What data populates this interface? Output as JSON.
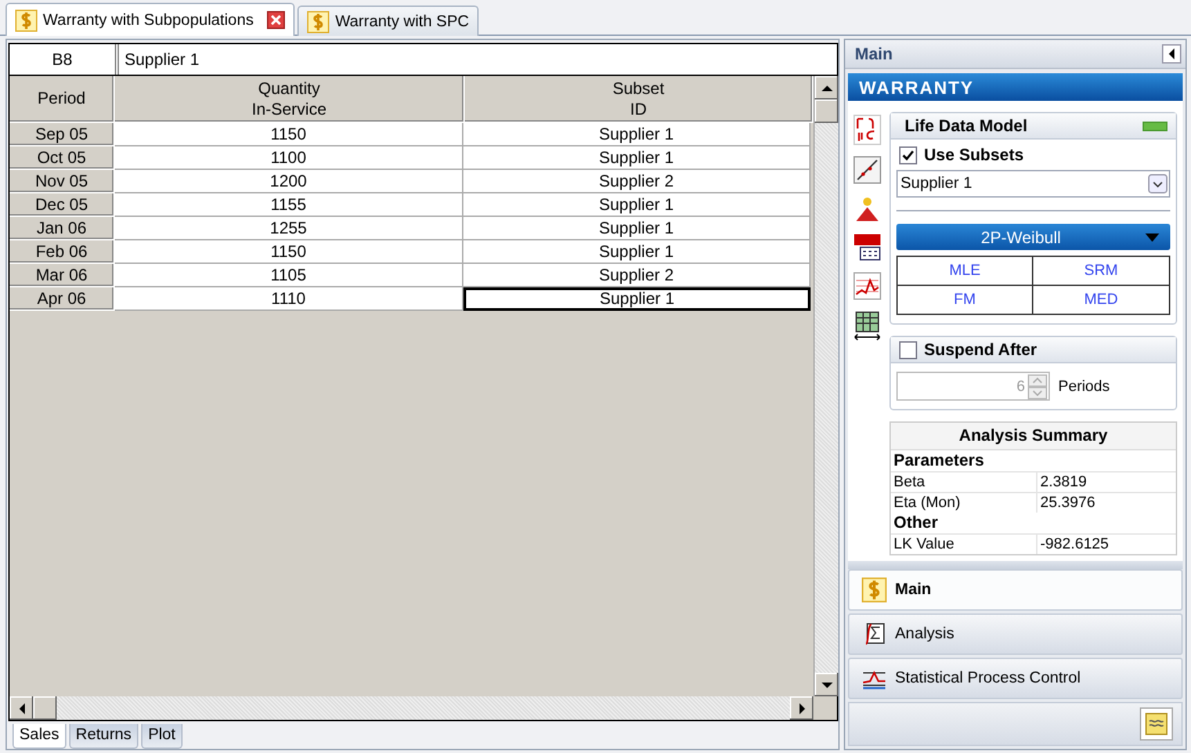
{
  "document_tabs": [
    {
      "label": "Warranty with Subpopulations",
      "selected": true,
      "closable": true
    },
    {
      "label": "Warranty with SPC",
      "selected": false,
      "closable": false
    }
  ],
  "cell_ref": "B8",
  "cell_value": "Supplier 1",
  "table": {
    "columns": [
      "Period",
      "Quantity\nIn-Service",
      "Subset\nID"
    ],
    "rows": [
      {
        "period": "Sep 05",
        "quantity": "1150",
        "subset": "Supplier 1",
        "selected": false
      },
      {
        "period": "Oct 05",
        "quantity": "1100",
        "subset": "Supplier 1",
        "selected": false
      },
      {
        "period": "Nov 05",
        "quantity": "1200",
        "subset": "Supplier 2",
        "selected": false
      },
      {
        "period": "Dec 05",
        "quantity": "1155",
        "subset": "Supplier 1",
        "selected": false
      },
      {
        "period": "Jan 06",
        "quantity": "1255",
        "subset": "Supplier 1",
        "selected": false
      },
      {
        "period": "Feb 06",
        "quantity": "1150",
        "subset": "Supplier 1",
        "selected": false
      },
      {
        "period": "Mar 06",
        "quantity": "1105",
        "subset": "Supplier 2",
        "selected": false
      },
      {
        "period": "Apr 06",
        "quantity": "1110",
        "subset": "Supplier 1",
        "selected": true
      }
    ]
  },
  "sheet_tabs": [
    {
      "label": "Sales",
      "selected": true
    },
    {
      "label": "Returns",
      "selected": false
    },
    {
      "label": "Plot",
      "selected": false
    }
  ],
  "panel": {
    "title": "Main",
    "banner": "WARRANTY",
    "life_data_model": {
      "title": "Life Data Model",
      "use_subsets": {
        "label": "Use Subsets",
        "checked": true
      },
      "subset": "Supplier 1",
      "distribution": "2P-Weibull",
      "methods": [
        "MLE",
        "SRM",
        "FM",
        "MED"
      ]
    },
    "suspend_after": {
      "label": "Suspend After",
      "checked": false,
      "value": "6",
      "unit": "Periods"
    },
    "summary": {
      "title": "Analysis Summary",
      "sections": [
        {
          "heading": "Parameters",
          "rows": [
            {
              "label": "Beta",
              "value": "2.3819"
            },
            {
              "label": "Eta (Mon)",
              "value": "25.3976"
            }
          ]
        },
        {
          "heading": "Other",
          "rows": [
            {
              "label": "LK Value",
              "value": "-982.6125"
            }
          ]
        }
      ]
    },
    "nav": [
      {
        "label": "Main",
        "selected": true,
        "kind": "dollar"
      },
      {
        "label": "Analysis",
        "selected": false,
        "kind": "analysis"
      },
      {
        "label": "Statistical Process Control",
        "selected": false,
        "kind": "spc"
      }
    ]
  }
}
